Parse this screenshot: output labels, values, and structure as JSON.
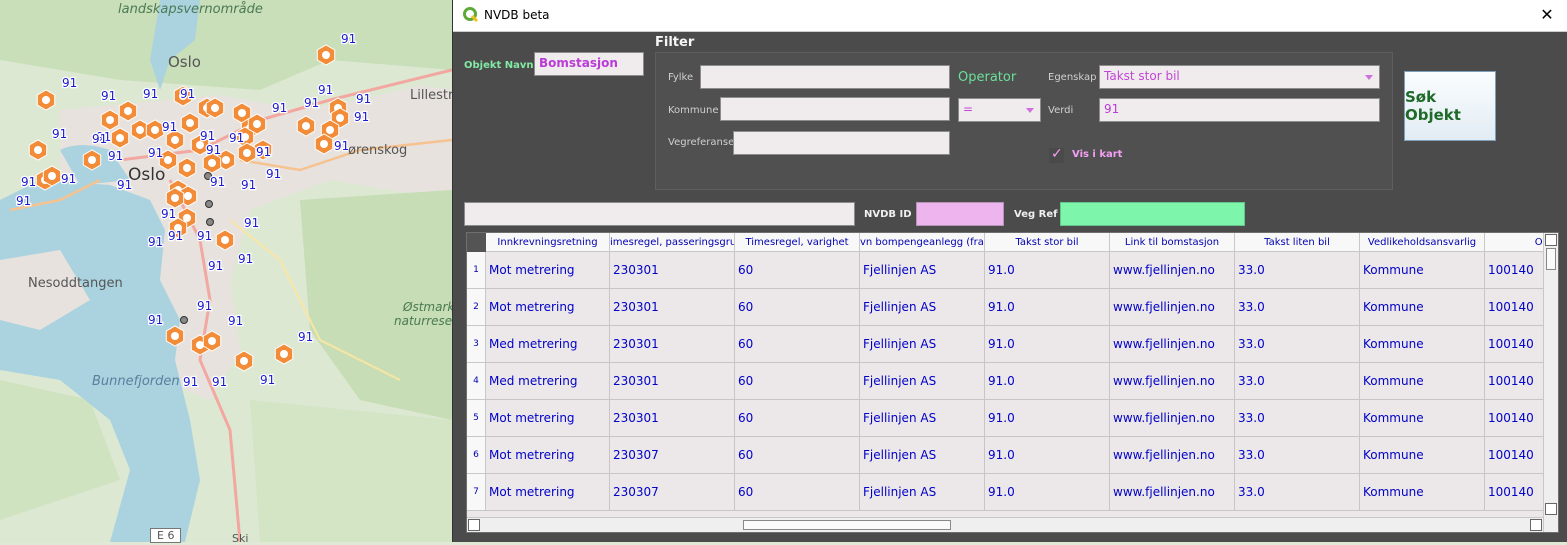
{
  "map": {
    "labels": {
      "landskap": "landskapsvernområde",
      "oslo_top": "Oslo",
      "oslo_city": "Oslo",
      "lillestrom": "Lilleströ",
      "lorenskog": "ørenskog",
      "nesoddtangen": "Nesoddtangen",
      "ostmark1": "Østmark",
      "ostmark2": "naturreser",
      "bunnefjorden": "Bunnefjorden",
      "e6": "E 6",
      "ski": "Ski"
    },
    "value_label": "91",
    "marker_color": "#f28c38"
  },
  "dialog": {
    "title": "NVDB beta",
    "close_glyph": "✕",
    "objekt_navn_label": "Objekt Navn",
    "objekt_navn_value": "Bomstasjon",
    "filter_heading": "Filter",
    "fylke_label": "Fylke",
    "kommune_label": "Kommune",
    "vegreferanse_label": "Vegreferanse",
    "operator_label": "Operator",
    "operator_value": "=",
    "egenskap_label": "Egenskap",
    "egenskap_value": "Takst stor bil",
    "verdi_label": "Verdi",
    "verdi_value": "91",
    "vis_i_kart_label": "Vis i kart",
    "search_button": "Søk Objekt",
    "nvdb_id_label": "NVDB ID",
    "veg_ref_label": "Veg Ref",
    "nvdb_id_color": "#eeb4ee",
    "veg_ref_color": "#7df5aa"
  },
  "table": {
    "headers": [
      "Innkrevningsretning",
      "imesregel, passeringsgrupp",
      "Timesregel, varighet",
      "vn bompengeanlegg (fra C",
      "Takst stor bil",
      "Link til bomstasjon",
      "Takst liten bil",
      "Vedlikeholdsansvarlig",
      "Oper"
    ],
    "rows": [
      {
        "num": "1",
        "cells": [
          "Mot metrering",
          "230301",
          "60",
          "Fjellinjen AS",
          "91.0",
          "www.fjellinjen.no",
          "33.0",
          "Kommune",
          "100140"
        ]
      },
      {
        "num": "2",
        "cells": [
          "Mot metrering",
          "230301",
          "60",
          "Fjellinjen AS",
          "91.0",
          "www.fjellinjen.no",
          "33.0",
          "Kommune",
          "100140"
        ]
      },
      {
        "num": "3",
        "cells": [
          "Med metrering",
          "230301",
          "60",
          "Fjellinjen AS",
          "91.0",
          "www.fjellinjen.no",
          "33.0",
          "Kommune",
          "100140"
        ]
      },
      {
        "num": "4",
        "cells": [
          "Med metrering",
          "230301",
          "60",
          "Fjellinjen AS",
          "91.0",
          "www.fjellinjen.no",
          "33.0",
          "Kommune",
          "100140"
        ]
      },
      {
        "num": "5",
        "cells": [
          "Mot metrering",
          "230301",
          "60",
          "Fjellinjen AS",
          "91.0",
          "www.fjellinjen.no",
          "33.0",
          "Kommune",
          "100140"
        ]
      },
      {
        "num": "6",
        "cells": [
          "Mot metrering",
          "230307",
          "60",
          "Fjellinjen AS",
          "91.0",
          "www.fjellinjen.no",
          "33.0",
          "Kommune",
          "100140"
        ]
      },
      {
        "num": "7",
        "cells": [
          "Mot metrering",
          "230307",
          "60",
          "Fjellinjen AS",
          "91.0",
          "www.fjellinjen.no",
          "33.0",
          "Kommune",
          "100140"
        ]
      }
    ]
  }
}
